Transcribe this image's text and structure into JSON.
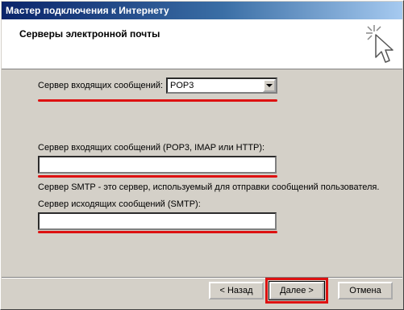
{
  "window": {
    "title": "Мастер подключения к Интернету"
  },
  "header": {
    "title": "Серверы электронной почты",
    "icon": "wizard-cursor-icon"
  },
  "form": {
    "incoming_type_label": "Сервер входящих сообщений:",
    "incoming_type_value": "POP3",
    "incoming_server_label": "Сервер входящих сообщений (POP3, IMAP или HTTP):",
    "incoming_server_value": "",
    "smtp_note": "Сервер SMTP - это сервер, используемый для отправки сообщений  пользователя.",
    "outgoing_server_label": "Сервер исходящих сообщений (SMTP):",
    "outgoing_server_value": ""
  },
  "buttons": {
    "back": "< Назад",
    "next": "Далее >",
    "cancel": "Отмена"
  },
  "colors": {
    "annotation": "#dd1111",
    "title_gradient_start": "#0a246a"
  }
}
